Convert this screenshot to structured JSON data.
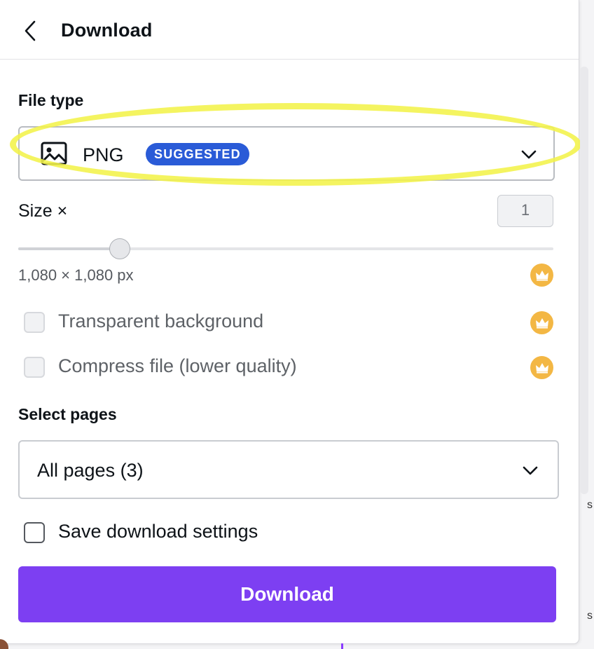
{
  "header": {
    "title": "Download",
    "back_icon": "chevron-left-icon"
  },
  "file_type": {
    "label": "File type",
    "selected": "PNG",
    "badge": "SUGGESTED",
    "icon": "image-icon",
    "badge_color": "#2a5bd7"
  },
  "size": {
    "label": "Size ×",
    "multiplier": "1",
    "slider_value": 0.19,
    "dimensions": "1,080 × 1,080 px",
    "pro_icon": "crown-icon"
  },
  "options": {
    "transparent_background": {
      "label": "Transparent background",
      "checked": false,
      "disabled": true,
      "pro_icon": "crown-icon"
    },
    "compress_file": {
      "label": "Compress file (lower quality)",
      "checked": false,
      "disabled": true,
      "pro_icon": "crown-icon"
    }
  },
  "pages": {
    "label": "Select pages",
    "selected": "All pages (3)"
  },
  "save_settings": {
    "label": "Save download settings",
    "checked": false
  },
  "download_button": {
    "label": "Download",
    "color": "#7d3ff2"
  },
  "colors": {
    "highlight": "#f2f24a",
    "crown": "#f3b744"
  }
}
